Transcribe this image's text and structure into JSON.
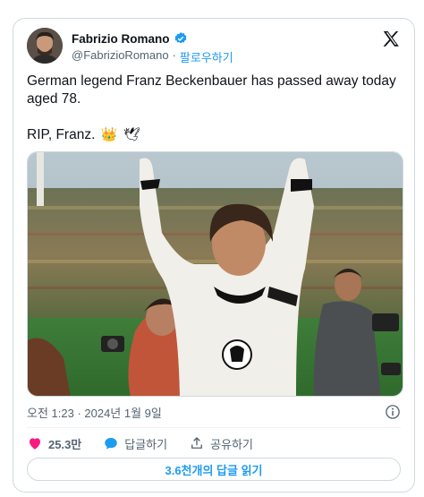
{
  "author": {
    "display_name": "Fabrizio Romano",
    "handle": "@FabrizioRomano",
    "separator": "·",
    "follow_label": "팔로우하기",
    "verified": true
  },
  "tweet": {
    "text_line1": "German legend Franz Beckenbauer has passed away today aged 78.",
    "text_line2": "RIP, Franz.",
    "emojis": [
      "crown",
      "dove"
    ],
    "timestamp": "오전 1:23 · 2024년 1월 9일"
  },
  "actions": {
    "likes_count": "25.3만",
    "reply_label": "답글하기",
    "share_label": "공유하기"
  },
  "read_replies_label": "3.6천개의 답글 읽기",
  "icons": [
    "x-logo",
    "verified-badge-icon",
    "info-icon",
    "heart-icon",
    "reply-bubble-icon",
    "share-icon"
  ],
  "colors": {
    "accent": "#1d9bf0",
    "like": "#f91880",
    "secondary_text": "#536471",
    "border": "#cfd9de"
  }
}
